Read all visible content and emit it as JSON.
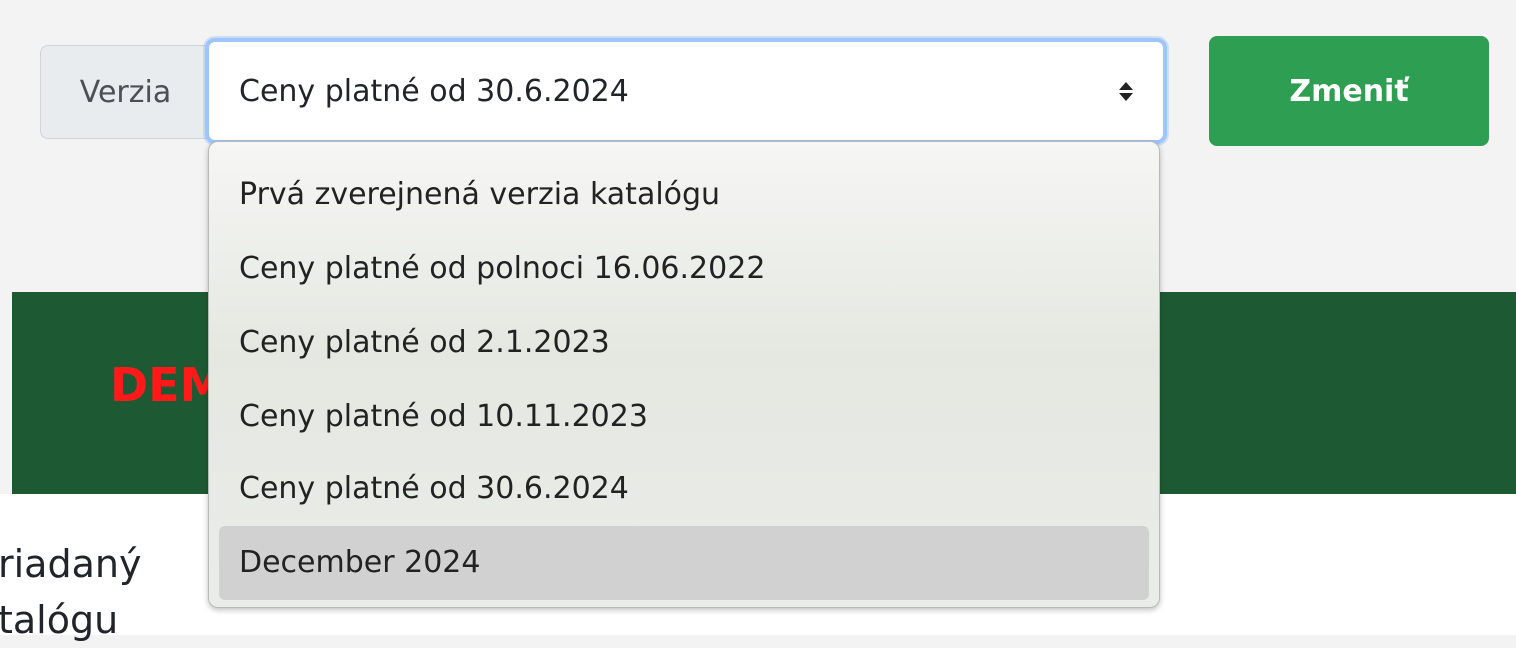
{
  "form": {
    "addon_label": "Verzia",
    "selected_value": "Ceny platné od 30.6.2024",
    "submit_label": "Zmeniť"
  },
  "dropdown": {
    "options": [
      "Prvá zverejnená verzia katalógu",
      "Ceny platné od polnoci 16.06.2022",
      "Ceny platné od 2.1.2023",
      "Ceny platné od 10.11.2023",
      "Ceny platné od 30.6.2024",
      "December 2024"
    ],
    "highlighted": "December 2024"
  },
  "banner": {
    "text": "DEM"
  },
  "content": {
    "line1": "riadaný",
    "line2": "talógu"
  },
  "colors": {
    "button": "#2e9e52",
    "banner": "#1d5a33",
    "banner_text": "#ff1a1a",
    "focus_border": "#9ec5fe"
  }
}
